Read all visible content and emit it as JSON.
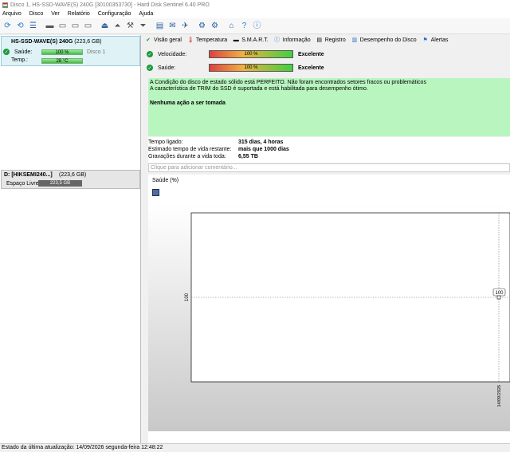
{
  "window": {
    "title": "Disco 1, HS-SSD-WAVE(S) 240G [30100353730]  -  Hard Disk Sentinel 6.40 PRO"
  },
  "menu": [
    "Arquivo",
    "Disco",
    "Ver",
    "Relatório",
    "Configuração",
    "Ajuda"
  ],
  "toolbar_icons": [
    "refresh-icon",
    "refresh-all-icon",
    "list-icon",
    "disk-hide-icon",
    "disk-icon",
    "disk-icon-2",
    "disk-icon-3",
    "eject-icon",
    "disk-up-icon",
    "disk-tools-icon",
    "disk-down-icon",
    "report-icon",
    "mail-icon",
    "tools-icon",
    "settings-icon",
    "settings-alt-icon",
    "camera-icon",
    "help-icon",
    "info-icon"
  ],
  "disk": {
    "name": "HS-SSD-WAVE(S) 240G",
    "size": "(223,6 GB)",
    "health_label": "Saúde:",
    "health_value": "100 %",
    "health_pct": 100,
    "disk_label": "Disco 1",
    "temp_label": "Temp.:",
    "temp_value": "28 °C"
  },
  "volume": {
    "name": "D: [HIKSEMI240...]",
    "size": "(223,6 GB)",
    "free_label": "Espaço Livre",
    "free_value": "223,5 GB"
  },
  "tabs": [
    {
      "label": "Visão geral",
      "icon": "check-icon"
    },
    {
      "label": "Temperatura",
      "icon": "thermometer-icon"
    },
    {
      "label": "S.M.A.R.T.",
      "icon": "smart-icon"
    },
    {
      "label": "Informação",
      "icon": "info-icon"
    },
    {
      "label": "Registro",
      "icon": "log-icon"
    },
    {
      "label": "Desempenho do Disco",
      "icon": "performance-icon"
    },
    {
      "label": "Alertas",
      "icon": "alert-icon"
    }
  ],
  "speed": {
    "label": "Velocidade:",
    "bar": "100 %",
    "value": "Excelente"
  },
  "health": {
    "label": "Saúde:",
    "bar": "100 %",
    "value": "Excelente"
  },
  "message": {
    "line1": "A Condição do disco de estado sólido está PERFEITO. Não foram encontrados setores fracos ou problemáticos",
    "line2": "A característica de TRIM do SSD é suportada e está habilitada para desempenho ótimo.",
    "action": "Nenhuma ação a ser tomada"
  },
  "stats": [
    {
      "key": "Tempo ligado:",
      "value": "315 dias, 4 horas"
    },
    {
      "key": "Estimado tempo de vida restante:",
      "value": "mais que 1000 dias"
    },
    {
      "key": "Gravações durante a vida toda:",
      "value": "6,55 TB"
    }
  ],
  "comment_placeholder": "Clique para adicionar comentário...",
  "chart_data": {
    "type": "line",
    "title": "Saúde (%)",
    "ylabel": "",
    "xlabel": "",
    "y_tick_left": "100",
    "x_tick": "14/09/2026",
    "series": [
      {
        "values": [
          100
        ],
        "x": [
          "14/09/2026"
        ]
      }
    ],
    "point_label": "100",
    "grid": true
  },
  "status": "Estado da última atualização: 14/09/2026 segunda-feira 12:48:22"
}
